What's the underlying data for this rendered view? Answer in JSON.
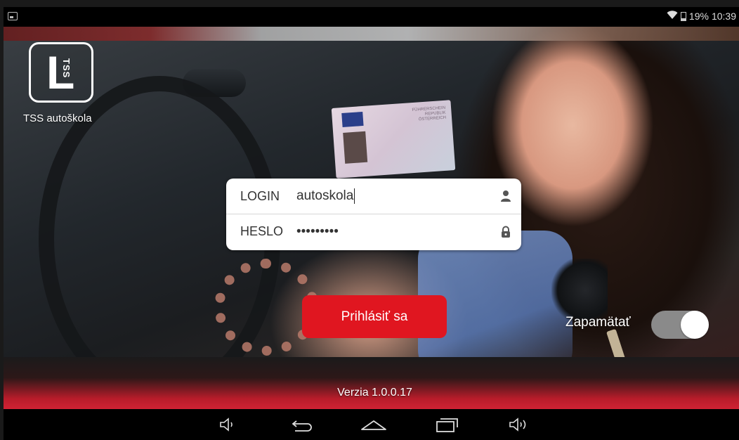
{
  "status_bar": {
    "battery": "19%",
    "time": "10:39"
  },
  "app": {
    "name": "TSS autoškola",
    "logo_letter": "L",
    "logo_sub": "TSS"
  },
  "background_card_text": "FÜHRERSCHEIN REPUBLIK ÖSTERREICH",
  "login": {
    "login_label": "LOGIN",
    "login_value": "autoskola",
    "password_label": "HESLO",
    "password_value": "•••••••••"
  },
  "login_button": "Prihlásiť sa",
  "remember": {
    "label": "Zapamätať",
    "enabled": true
  },
  "version": "Verzia 1.0.0.17",
  "colors": {
    "accent": "#e01620",
    "toggle_track": "#8a8a8a"
  },
  "icons": {
    "login_field": "user-icon",
    "password_field": "lock-icon"
  }
}
